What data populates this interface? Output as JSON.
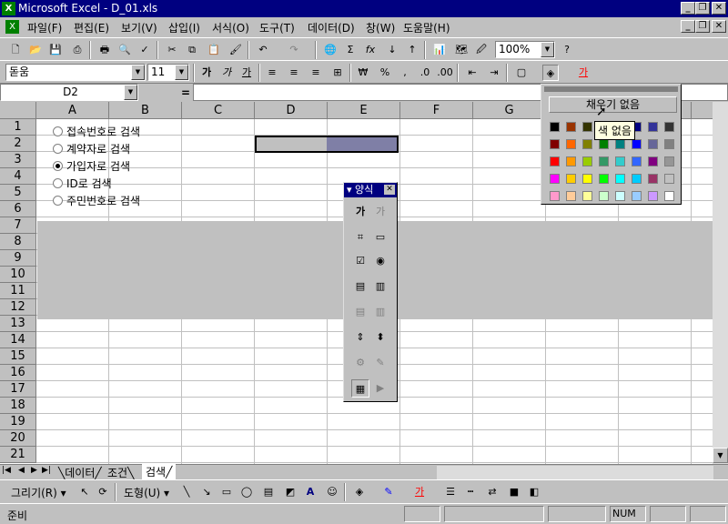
{
  "window": {
    "title": "Microsoft Excel - D_01.xls",
    "min": "_",
    "restore": "❐",
    "close": "✕"
  },
  "menu": [
    "파일(F)",
    "편집(E)",
    "보기(V)",
    "삽입(I)",
    "서식(O)",
    "도구(T)",
    "데이터(D)",
    "창(W)",
    "도움말(H)"
  ],
  "toolbar": {
    "zoom": "100%",
    "font": "돋움",
    "size": "11"
  },
  "formula": {
    "namebox": "D2",
    "eq": "="
  },
  "columns": [
    "A",
    "B",
    "C",
    "D",
    "E",
    "F",
    "G",
    "H",
    "I",
    "J"
  ],
  "rows": [
    "1",
    "2",
    "3",
    "4",
    "5",
    "6",
    "7",
    "8",
    "9",
    "10",
    "11",
    "12",
    "13",
    "14",
    "15",
    "16",
    "17",
    "18",
    "19",
    "20",
    "21"
  ],
  "options": [
    {
      "label": "접속번호로 검색",
      "checked": false
    },
    {
      "label": "계약자로 검색",
      "checked": false
    },
    {
      "label": "가입자로 검색",
      "checked": true
    },
    {
      "label": "ID로 검색",
      "checked": false
    },
    {
      "label": "주민번호로 검색",
      "checked": false
    }
  ],
  "forms_toolbar": {
    "title": "양식",
    "label_btn": "가",
    "edit_btn": "가"
  },
  "palette": {
    "no_fill": "채우기 없음",
    "tooltip": "색 없음",
    "colors": [
      "#000000",
      "#993300",
      "#333300",
      "#003300",
      "#003366",
      "#000080",
      "#333399",
      "#333333",
      "#800000",
      "#ff6600",
      "#808000",
      "#008000",
      "#008080",
      "#0000ff",
      "#666699",
      "#808080",
      "#ff0000",
      "#ff9900",
      "#99cc00",
      "#339966",
      "#33cccc",
      "#3366ff",
      "#800080",
      "#969696",
      "#ff00ff",
      "#ffcc00",
      "#ffff00",
      "#00ff00",
      "#00ffff",
      "#00ccff",
      "#993366",
      "#c0c0c0",
      "#ff99cc",
      "#ffcc99",
      "#ffff99",
      "#ccffcc",
      "#ccffff",
      "#99ccff",
      "#cc99ff",
      "#ffffff"
    ]
  },
  "sheets": {
    "tab1": "데이터",
    "tab2": "조건",
    "tab3": "검색"
  },
  "drawbar": {
    "draw": "그리기(R)",
    "autoshape": "도형(U)"
  },
  "status": {
    "ready": "준비",
    "num": "NUM"
  }
}
